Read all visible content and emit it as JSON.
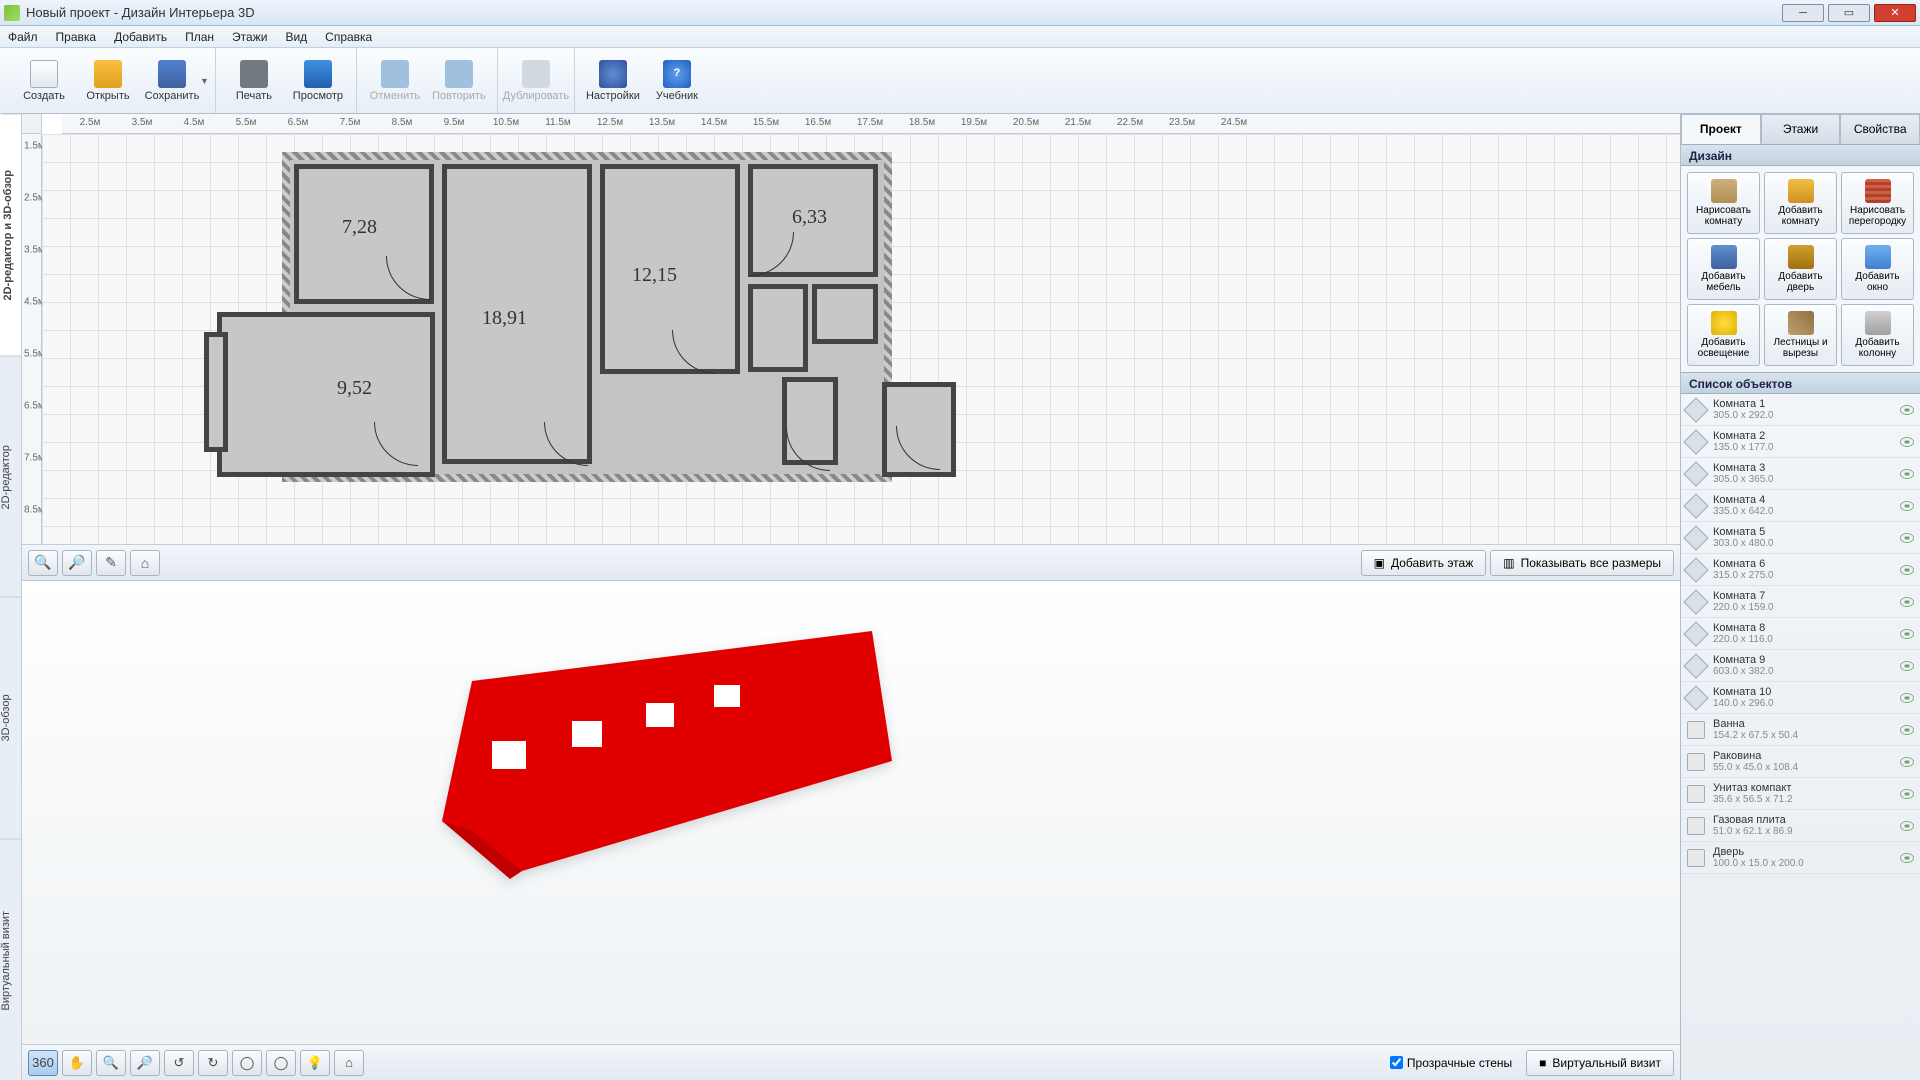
{
  "window": {
    "title": "Новый проект - Дизайн Интерьера 3D"
  },
  "menu": [
    "Файл",
    "Правка",
    "Добавить",
    "План",
    "Этажи",
    "Вид",
    "Справка"
  ],
  "toolbar": {
    "new": "Создать",
    "open": "Открыть",
    "save": "Сохранить",
    "print": "Печать",
    "view": "Просмотр",
    "undo": "Отменить",
    "redo": "Повторить",
    "dup": "Дублировать",
    "settings": "Настройки",
    "help": "Учебник"
  },
  "vtabs": [
    "2D-редактор и 3D-обзор",
    "2D-редактор",
    "3D-обзор",
    "Виртуальный визит"
  ],
  "ruler_h": [
    "2.5м",
    "3.5м",
    "4.5м",
    "5.5м",
    "6.5м",
    "7.5м",
    "8.5м",
    "9.5м",
    "10.5м",
    "11.5м",
    "12.5м",
    "13.5м",
    "14.5м",
    "15.5м",
    "16.5м",
    "17.5м",
    "18.5м",
    "19.5м",
    "20.5м",
    "21.5м",
    "22.5м",
    "23.5м",
    "24.5м"
  ],
  "ruler_v": [
    "1.5м",
    "2.5м",
    "3.5м",
    "4.5м",
    "5.5м",
    "6.5м",
    "7.5м",
    "8.5м"
  ],
  "plan_labels": {
    "r1": "7,28",
    "r2": "18,91",
    "r3": "12,15",
    "r4": "6,33",
    "r5": "9,52"
  },
  "bar2d": {
    "add_floor": "Добавить этаж",
    "show_dims": "Показывать все размеры"
  },
  "bar3d": {
    "transparent": "Прозрачные стены",
    "virtual": "Виртуальный визит"
  },
  "right": {
    "tabs": [
      "Проект",
      "Этажи",
      "Свойства"
    ],
    "design_head": "Дизайн",
    "objects_head": "Список объектов",
    "design_buttons": [
      "Нарисовать комнату",
      "Добавить комнату",
      "Нарисовать перегородку",
      "Добавить мебель",
      "Добавить дверь",
      "Добавить окно",
      "Добавить освещение",
      "Лестницы и вырезы",
      "Добавить колонну"
    ],
    "objects": [
      {
        "name": "Комната 1",
        "dim": "305.0 x 292.0",
        "type": "room"
      },
      {
        "name": "Комната 2",
        "dim": "135.0 x 177.0",
        "type": "room"
      },
      {
        "name": "Комната 3",
        "dim": "305.0 x 365.0",
        "type": "room"
      },
      {
        "name": "Комната 4",
        "dim": "335.0 x 642.0",
        "type": "room"
      },
      {
        "name": "Комната 5",
        "dim": "303.0 x 480.0",
        "type": "room"
      },
      {
        "name": "Комната 6",
        "dim": "315.0 x 275.0",
        "type": "room"
      },
      {
        "name": "Комната 7",
        "dim": "220.0 x 159.0",
        "type": "room"
      },
      {
        "name": "Комната 8",
        "dim": "220.0 x 116.0",
        "type": "room"
      },
      {
        "name": "Комната 9",
        "dim": "603.0 x 382.0",
        "type": "room"
      },
      {
        "name": "Комната 10",
        "dim": "140.0 x 296.0",
        "type": "room"
      },
      {
        "name": "Ванна",
        "dim": "154.2 x 67.5 x 50.4",
        "type": "obj"
      },
      {
        "name": "Раковина",
        "dim": "55.0 x 45.0 x 108.4",
        "type": "obj"
      },
      {
        "name": "Унитаз компакт",
        "dim": "35.6 x 56.5 x 71.2",
        "type": "obj"
      },
      {
        "name": "Газовая плита",
        "dim": "51.0 x 62.1 x 86.9",
        "type": "obj"
      },
      {
        "name": "Дверь",
        "dim": "100.0 x 15.0 x 200.0",
        "type": "obj"
      }
    ]
  }
}
